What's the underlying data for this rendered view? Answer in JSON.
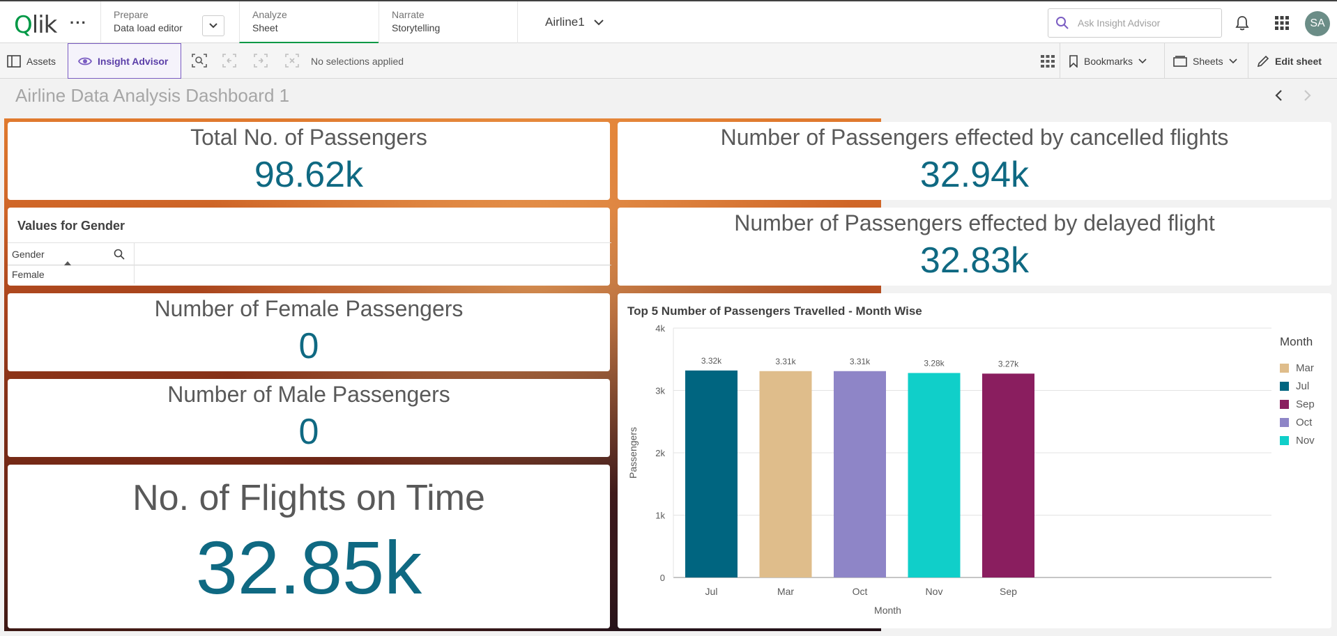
{
  "nav": {
    "prepare": {
      "k": "Prepare",
      "v": "Data load editor"
    },
    "analyze": {
      "k": "Analyze",
      "v": "Sheet"
    },
    "narrate": {
      "k": "Narrate",
      "v": "Storytelling"
    },
    "app_title": "Airline1",
    "search_placeholder": "Ask Insight Advisor",
    "avatar": "SA"
  },
  "toolbar": {
    "assets": "Assets",
    "insight_advisor": "Insight Advisor",
    "no_selections": "No selections applied",
    "bookmarks": "Bookmarks",
    "sheets": "Sheets",
    "edit_sheet": "Edit sheet"
  },
  "sheet": {
    "title": "Airline Data Analysis Dashboard 1"
  },
  "kpis": {
    "total_passengers": {
      "label": "Total No. of Passengers",
      "value": "98.62k"
    },
    "cancelled": {
      "label": "Number of Passengers effected by cancelled flights",
      "value": "32.94k"
    },
    "delayed": {
      "label": "Number of Passengers effected by delayed flight",
      "value": "32.83k"
    },
    "female": {
      "label": "Number of Female Passengers",
      "value": "0"
    },
    "male": {
      "label": "Number of Male Passengers",
      "value": "0"
    },
    "on_time": {
      "label": "No. of Flights on Time",
      "value": "32.85k"
    }
  },
  "filter_pane": {
    "title": "Values for Gender",
    "column": "Gender",
    "rows": [
      "Female"
    ]
  },
  "chart_data": {
    "type": "bar",
    "title": "Top 5 Number of Passengers Travelled - Month Wise",
    "xlabel": "Month",
    "ylabel": "Passengers",
    "categories": [
      "Jul",
      "Mar",
      "Oct",
      "Nov",
      "Sep"
    ],
    "values": [
      3320,
      3310,
      3310,
      3280,
      3270
    ],
    "data_labels": [
      "3.32k",
      "3.31k",
      "3.31k",
      "3.28k",
      "3.27k"
    ],
    "colors": [
      "#006580",
      "#dfbd8b",
      "#8e85c7",
      "#10cfc9",
      "#8a1e5f"
    ],
    "ylim": [
      0,
      4000
    ],
    "yticks": [
      0,
      1000,
      2000,
      3000,
      4000
    ],
    "ytick_labels": [
      "0",
      "1k",
      "2k",
      "3k",
      "4k"
    ],
    "grid": true,
    "legend": {
      "title": "Month",
      "position": "right",
      "items": [
        {
          "label": "Mar",
          "color": "#dfbd8b"
        },
        {
          "label": "Jul",
          "color": "#006580"
        },
        {
          "label": "Sep",
          "color": "#8a1e5f"
        },
        {
          "label": "Oct",
          "color": "#8e85c7"
        },
        {
          "label": "Nov",
          "color": "#10cfc9"
        }
      ]
    }
  }
}
